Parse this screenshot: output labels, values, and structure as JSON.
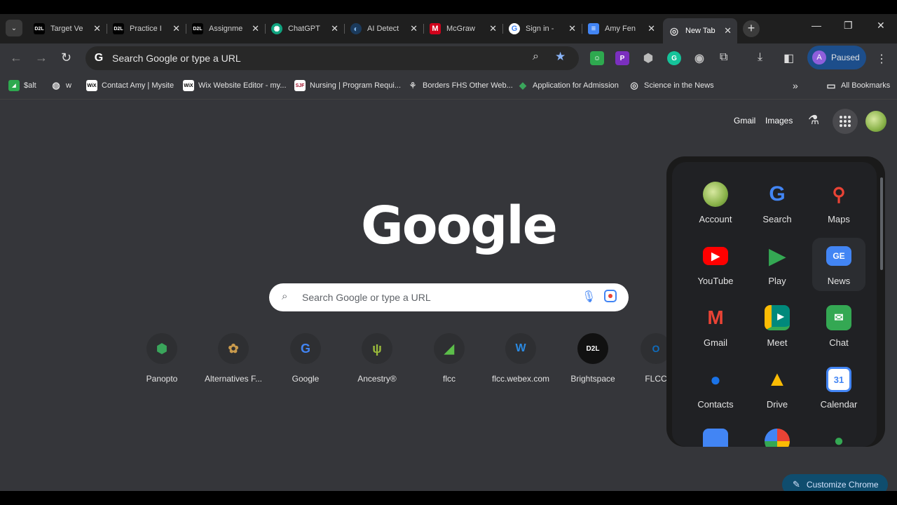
{
  "tabs": [
    {
      "title": "Target Ve",
      "icon": "d2l-icon",
      "badge": "D2L"
    },
    {
      "title": "Practice I",
      "icon": "d2l-icon",
      "badge": "D2L"
    },
    {
      "title": "Assignme",
      "icon": "d2l-icon",
      "badge": "D2L"
    },
    {
      "title": "ChatGPT",
      "icon": "chatgpt-icon",
      "badge": "✺"
    },
    {
      "title": "AI Detect",
      "icon": "ai-detect-icon",
      "badge": "◐"
    },
    {
      "title": "McGraw",
      "icon": "mcgraw-icon",
      "badge": "M"
    },
    {
      "title": "Sign in -",
      "icon": "google-icon",
      "badge": "G"
    },
    {
      "title": "Amy Fen",
      "icon": "docs-icon",
      "badge": "≡"
    },
    {
      "title": "New Tab",
      "icon": "chrome-icon",
      "badge": "◎"
    }
  ],
  "toolbar": {
    "omnibox_text": "Search Google or type a URL",
    "profile_initial": "A",
    "profile_label": "Paused"
  },
  "bookmarks": [
    {
      "label": "$alt",
      "icon": "leaf-icon"
    },
    {
      "label": "w",
      "icon": "globe-icon"
    },
    {
      "label": "Contact Amy | Mysite",
      "icon": "wix-icon",
      "badge": "WiX"
    },
    {
      "label": "Wix Website Editor - my...",
      "icon": "wix-icon",
      "badge": "WiX"
    },
    {
      "label": "Nursing | Program Requi...",
      "icon": "sjf-icon",
      "badge": "SJF"
    },
    {
      "label": "Borders FHS Other Web...",
      "icon": "borders-icon",
      "badge": "⚘"
    },
    {
      "label": "Application for Admission",
      "icon": "panoptic-icon",
      "badge": "◆"
    },
    {
      "label": "Science in the News",
      "icon": "globe-icon",
      "badge": "◎"
    }
  ],
  "all_bookmarks": "All Bookmarks",
  "header_links": {
    "gmail": "Gmail",
    "images": "Images"
  },
  "search": {
    "placeholder": "Search Google or type a URL"
  },
  "logo_text": "Google",
  "shortcuts": [
    {
      "label": "Panopto",
      "badge": "⬢",
      "color": "#3aa55b"
    },
    {
      "label": "Alternatives F...",
      "badge": "✿",
      "color": "#c99a4c"
    },
    {
      "label": "Google",
      "badge": "G",
      "color": "#4285f4"
    },
    {
      "label": "Ancestry®",
      "badge": "ψ",
      "color": "#9bbb3b"
    },
    {
      "label": "flcc",
      "badge": "◢",
      "color": "#5cbf4a"
    },
    {
      "label": "flcc.webex.com",
      "badge": "W",
      "color": "#2b8ae2"
    },
    {
      "label": "Brightspace",
      "badge": "D2L",
      "color": "#ffffff"
    },
    {
      "label": "FLCC",
      "badge": "O",
      "color": "#0f6cbd"
    }
  ],
  "apps": [
    {
      "label": "Account",
      "badge": "",
      "color": "#8ab34a"
    },
    {
      "label": "Search",
      "badge": "G",
      "color": "#4285f4"
    },
    {
      "label": "Maps",
      "badge": "⬤",
      "color": "#34a853"
    },
    {
      "label": "YouTube",
      "badge": "▶",
      "color": "#ff0000"
    },
    {
      "label": "Play",
      "badge": "▶",
      "color": "#00a0ff"
    },
    {
      "label": "News",
      "badge": "GE",
      "color": "#4285f4"
    },
    {
      "label": "Gmail",
      "badge": "M",
      "color": "#ea4335"
    },
    {
      "label": "Meet",
      "badge": "▶",
      "color": "#00897b"
    },
    {
      "label": "Chat",
      "badge": "✉",
      "color": "#34a853"
    },
    {
      "label": "Contacts",
      "badge": "●",
      "color": "#1a73e8"
    },
    {
      "label": "Drive",
      "badge": "▲",
      "color": "#fbbc04"
    },
    {
      "label": "Calendar",
      "badge": "31",
      "color": "#4285f4"
    }
  ],
  "customize_label": "Customize Chrome"
}
